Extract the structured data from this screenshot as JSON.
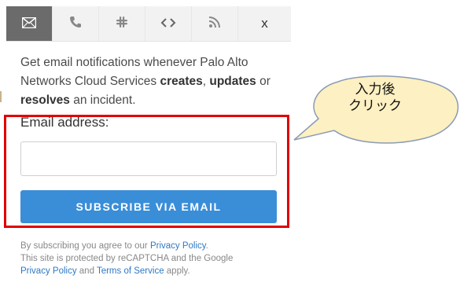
{
  "tabs": [
    {
      "name": "email",
      "icon": "envelope-icon",
      "glyph": "✉",
      "active": true
    },
    {
      "name": "phone",
      "icon": "phone-icon",
      "glyph": "📞",
      "active": false
    },
    {
      "name": "slack",
      "icon": "slack-icon",
      "glyph": "#",
      "active": false
    },
    {
      "name": "webhook",
      "icon": "code-icon",
      "glyph": "<>",
      "active": false
    },
    {
      "name": "rss",
      "icon": "rss-icon",
      "glyph": "◔",
      "active": false
    },
    {
      "name": "close",
      "icon": "close-icon",
      "glyph": "x",
      "active": false
    }
  ],
  "description": {
    "part1": "Get email notifications whenever Palo Alto Networks Cloud Services ",
    "bold1": "creates",
    "sep1": ", ",
    "bold2": "updates",
    "sep2": " or ",
    "bold3": "resolves",
    "part2": " an incident."
  },
  "form": {
    "email_label": "Email address:",
    "email_value": "",
    "email_placeholder": "",
    "subscribe_label": "SUBSCRIBE VIA EMAIL"
  },
  "fine_print": {
    "p1": "By subscribing you agree to our ",
    "link1": "Privacy Policy",
    "p2": ".",
    "p3": "This site is protected by reCAPTCHA and the Google ",
    "link2": "Privacy Policy",
    "p4": " and ",
    "link3": "Terms of Service",
    "p5": " apply."
  },
  "callout": {
    "line1": "入力後",
    "line2": "クリック",
    "fill": "#fdf0c2",
    "stroke": "#8a9bb5"
  },
  "highlight_color": "#e00000"
}
